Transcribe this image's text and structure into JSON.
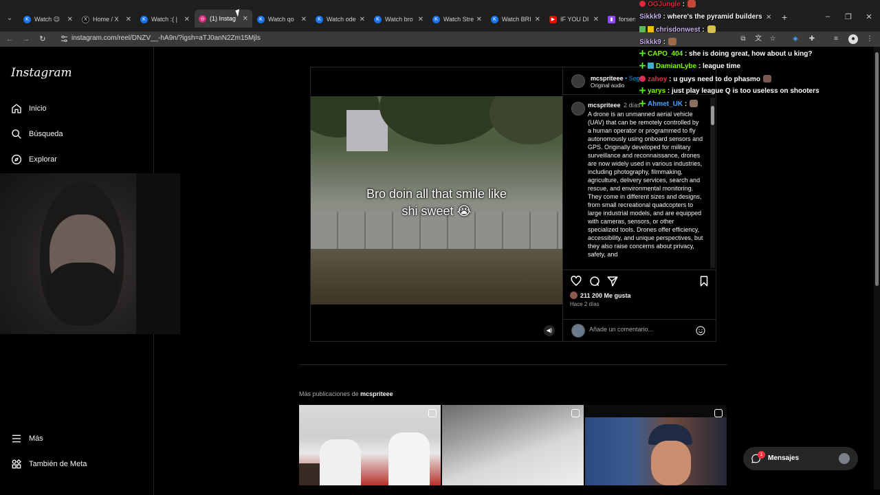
{
  "browser": {
    "tabs": [
      {
        "title": "Watch 😉",
        "favicon": "kick-icon"
      },
      {
        "title": "Home / X",
        "favicon": "x-icon"
      },
      {
        "title": "Watch :( |",
        "favicon": "kick-icon"
      },
      {
        "title": "(1) Instag",
        "favicon": "instagram-icon",
        "active": true
      },
      {
        "title": "Watch qo",
        "favicon": "kick-icon"
      },
      {
        "title": "Watch ode",
        "favicon": "kick-icon"
      },
      {
        "title": "Watch bro",
        "favicon": "kick-icon"
      },
      {
        "title": "Watch Stre",
        "favicon": "kick-icon"
      },
      {
        "title": "Watch BRI",
        "favicon": "kick-icon"
      },
      {
        "title": "IF YOU DI",
        "favicon": "youtube-icon"
      },
      {
        "title": "forsen -",
        "favicon": "twitch-icon"
      }
    ],
    "url": "instagram.com/reel/DNZV__-hA9n/?igsh=aTJ0anN2Zm15Mjls"
  },
  "instagram": {
    "logo": "Instagram",
    "nav": {
      "home": "Inicio",
      "search": "Búsqueda",
      "explore": "Explorar",
      "more": "Más",
      "meta": "También de Meta"
    },
    "post": {
      "video_caption_line1": "Bro doin all that smile like",
      "video_caption_line2": "shi sweet 😭",
      "username": "mcspriteee",
      "dot_follow": "• Segu",
      "audio": "Original audio",
      "comment_user": "mcspriteee",
      "comment_time": "2 días",
      "comment_text": "A drone is an unmanned aerial vehicle (UAV) that can be remotely controlled by a human operator or programmed to fly autonomously using onboard sensors and GPS. Originally developed for military surveillance and reconnaissance, drones are now widely used in various industries, including photography, filmmaking, agriculture, delivery services, search and rescue, and environmental monitoring. They come in different sizes and designs, from small recreational quadcopters to large industrial models, and are equipped with cameras, sensors, or other specialized tools. Drones offer efficiency, accessibility, and unique perspectives, but they also raise concerns about privacy, safety, and",
      "likes": "211 200 Me gusta",
      "posted_ago": "Hace 2 días",
      "comment_placeholder": "Añade un comentario..."
    },
    "more_posts": {
      "prefix": "Más publicaciones de",
      "user": "mcspriteee"
    },
    "messages": {
      "label": "Mensajes",
      "badge": "1"
    }
  },
  "chat": [
    {
      "user": "OGJungle",
      "sep": ":",
      "text": "",
      "color": "#e2263b"
    },
    {
      "user": "Sikkk9",
      "sep": ":",
      "text": "where's the pyramid builders",
      "color": "#c8b2f0"
    },
    {
      "user": "chrisdonwest",
      "sep": ":",
      "text": "",
      "color": "#c8b2f0"
    },
    {
      "user": "Sikkk9",
      "sep": ":",
      "text": "",
      "color": "#c8b2f0"
    },
    {
      "user": "CAPO_404",
      "sep": ":",
      "text": "she is doing great, how about u king?",
      "color": "#7cfc00"
    },
    {
      "user": "DamianLybe",
      "sep": ":",
      "text": "league time",
      "color": "#7cfc00"
    },
    {
      "user": "zahoy",
      "sep": ":",
      "text": "u guys need to do phasmo",
      "color": "#e0304a"
    },
    {
      "user": "yarys",
      "sep": ":",
      "text": "just play league Q is too useless on shooters",
      "color": "#7cfc00"
    },
    {
      "user": "Ahmet_UK",
      "sep": ":",
      "text": "",
      "color": "#4aa3ff"
    }
  ]
}
